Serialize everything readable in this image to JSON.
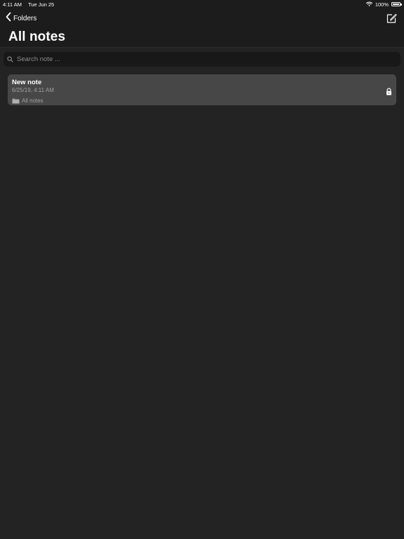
{
  "status_bar": {
    "time": "4:11 AM",
    "date": "Tue Jun 25",
    "battery": "100%",
    "icons": [
      "wifi-icon",
      "battery-icon"
    ]
  },
  "header": {
    "back_label": "Folders",
    "title": "All notes",
    "compose_icon": "compose-icon"
  },
  "search": {
    "placeholder": "Search note ...",
    "value": ""
  },
  "notes": [
    {
      "title": "New note",
      "date": "6/25/19, 4:11 AM",
      "folder": "All notes",
      "locked": true
    }
  ],
  "colors": {
    "background": "#232323",
    "header_background": "#1c1c1c",
    "search_background": "#181818",
    "note_background": "#474747",
    "secondary_text": "#a0a0a0"
  }
}
